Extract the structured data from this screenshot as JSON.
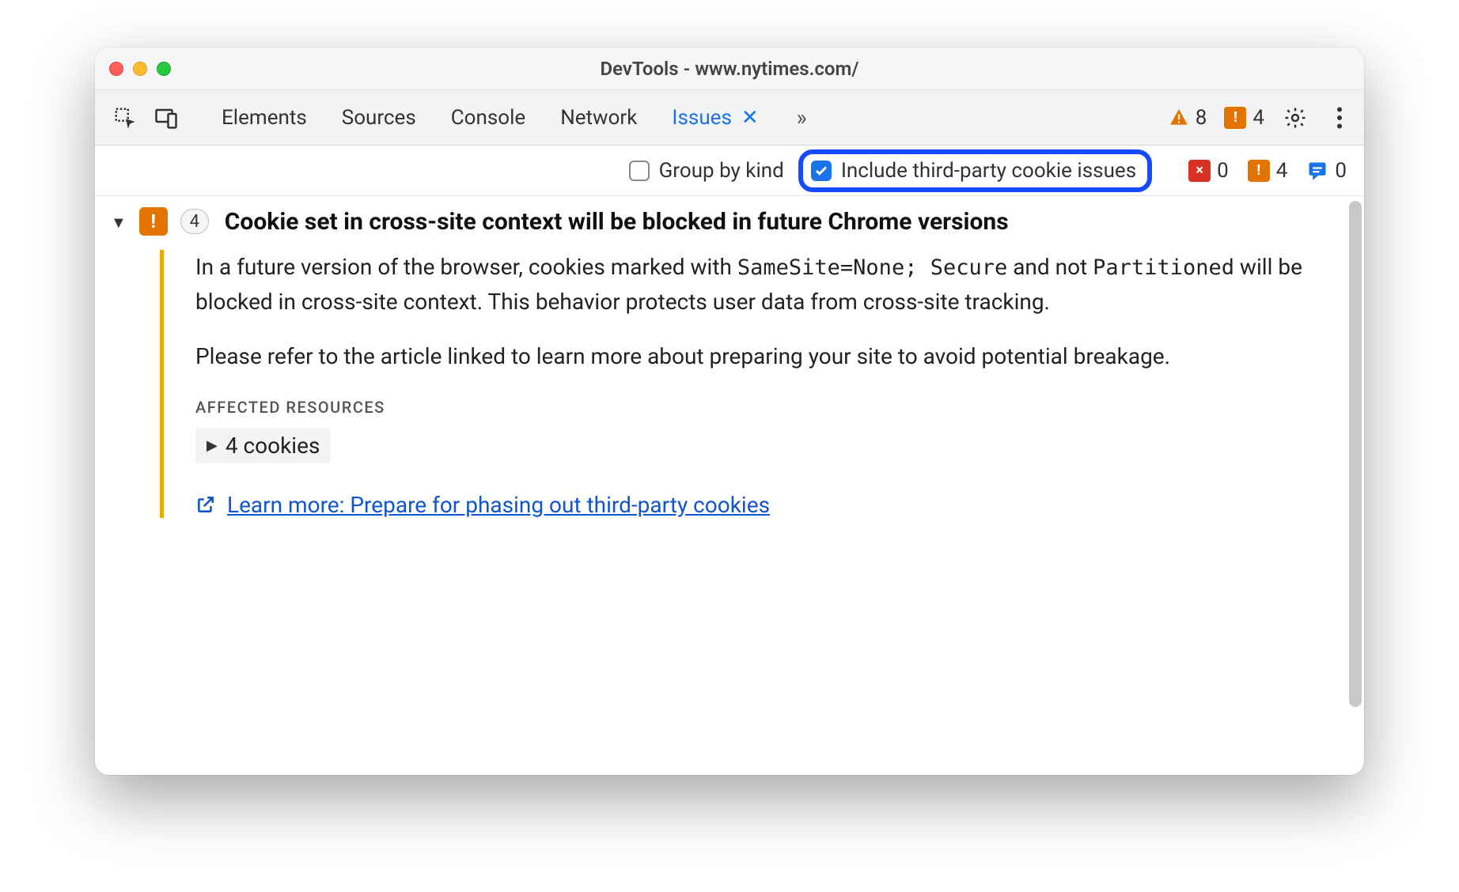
{
  "window": {
    "title": "DevTools - www.nytimes.com/"
  },
  "toolbar": {
    "tabs": [
      "Elements",
      "Sources",
      "Console",
      "Network",
      "Issues"
    ],
    "active_tab_index": 4,
    "error_count": "8",
    "warn_count": "4"
  },
  "filter": {
    "group_label": "Group by kind",
    "group_checked": false,
    "thirdparty_label": "Include third-party cookie issues",
    "thirdparty_checked": true,
    "counts": {
      "error": "0",
      "warn": "4",
      "info": "0"
    }
  },
  "issue": {
    "count": "4",
    "title": "Cookie set in cross-site context will be blocked in future Chrome versions",
    "p1_a": "In a future version of the browser, cookies marked with ",
    "p1_code1": "SameSite=None; Secure",
    "p1_b": " and not ",
    "p1_code2": "Partitioned",
    "p1_c": " will be blocked in cross-site context. This behavior protects user data from cross-site tracking.",
    "p2": "Please refer to the article linked to learn more about preparing your site to avoid potential breakage.",
    "section_label": "AFFECTED RESOURCES",
    "cookies_label": "4 cookies",
    "learn_more": "Learn more: Prepare for phasing out third-party cookies"
  }
}
